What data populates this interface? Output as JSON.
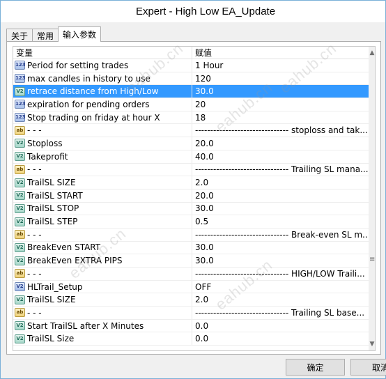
{
  "window": {
    "title": "Expert - High Low EA_Update"
  },
  "tabs": [
    {
      "label": "关于"
    },
    {
      "label": "常用"
    },
    {
      "label": "输入参数"
    }
  ],
  "grid": {
    "columns": [
      "变量",
      "赋值"
    ],
    "rows": [
      {
        "icon": "int",
        "icon_text": "123",
        "name": "Period for setting trades",
        "value": "1 Hour"
      },
      {
        "icon": "int",
        "icon_text": "123",
        "name": "max candles in history to use",
        "value": "120"
      },
      {
        "icon": "dbl",
        "icon_text": "V2",
        "name": "retrace distance from High/Low",
        "value": "30.0",
        "selected": true
      },
      {
        "icon": "int",
        "icon_text": "123",
        "name": "expiration for pending orders",
        "value": "20"
      },
      {
        "icon": "int",
        "icon_text": "123",
        "name": "Stop trading on friday at hour X",
        "value": "18"
      },
      {
        "icon": "str",
        "icon_text": "ab",
        "name": "- - -",
        "value": "------------------------------- stoploss and tak..."
      },
      {
        "icon": "dbl",
        "icon_text": "V2",
        "name": "Stoploss",
        "value": "20.0"
      },
      {
        "icon": "dbl",
        "icon_text": "V2",
        "name": "Takeprofit",
        "value": "40.0"
      },
      {
        "icon": "str",
        "icon_text": "ab",
        "name": "- - -",
        "value": "------------------------------- Trailing SL mana..."
      },
      {
        "icon": "dbl",
        "icon_text": "V2",
        "name": "TrailSL SIZE",
        "value": "2.0"
      },
      {
        "icon": "dbl",
        "icon_text": "V2",
        "name": "TrailSL START",
        "value": "20.0"
      },
      {
        "icon": "dbl",
        "icon_text": "V2",
        "name": "TrailSL STOP",
        "value": "30.0"
      },
      {
        "icon": "dbl",
        "icon_text": "V2",
        "name": "TrailSL STEP",
        "value": "0.5"
      },
      {
        "icon": "str",
        "icon_text": "ab",
        "name": "- - -",
        "value": "------------------------------- Break-even SL m..."
      },
      {
        "icon": "dbl",
        "icon_text": "V2",
        "name": "BreakEven START",
        "value": "30.0"
      },
      {
        "icon": "dbl",
        "icon_text": "V2",
        "name": "BreakEven EXTRA PIPS",
        "value": "30.0"
      },
      {
        "icon": "str",
        "icon_text": "ab",
        "name": "- - -",
        "value": "------------------------------- HIGH/LOW Traili..."
      },
      {
        "icon": "bool",
        "icon_text": "V2",
        "name": "HLTrail_Setup",
        "value": "OFF"
      },
      {
        "icon": "dbl",
        "icon_text": "V2",
        "name": "TrailSL SIZE",
        "value": "2.0"
      },
      {
        "icon": "str",
        "icon_text": "ab",
        "name": "- - -",
        "value": "------------------------------- Trailing SL base..."
      },
      {
        "icon": "dbl",
        "icon_text": "V2",
        "name": "Start TrailSL after X Minutes",
        "value": "0.0"
      },
      {
        "icon": "dbl",
        "icon_text": "V2",
        "name": "TrailSL Size",
        "value": "0.0"
      }
    ]
  },
  "buttons": {
    "ok": "确定",
    "cancel": "取消"
  },
  "watermark": "eahub.cn",
  "colors": {
    "selection": "#3399ff",
    "window_border": "#7ab0d8"
  }
}
